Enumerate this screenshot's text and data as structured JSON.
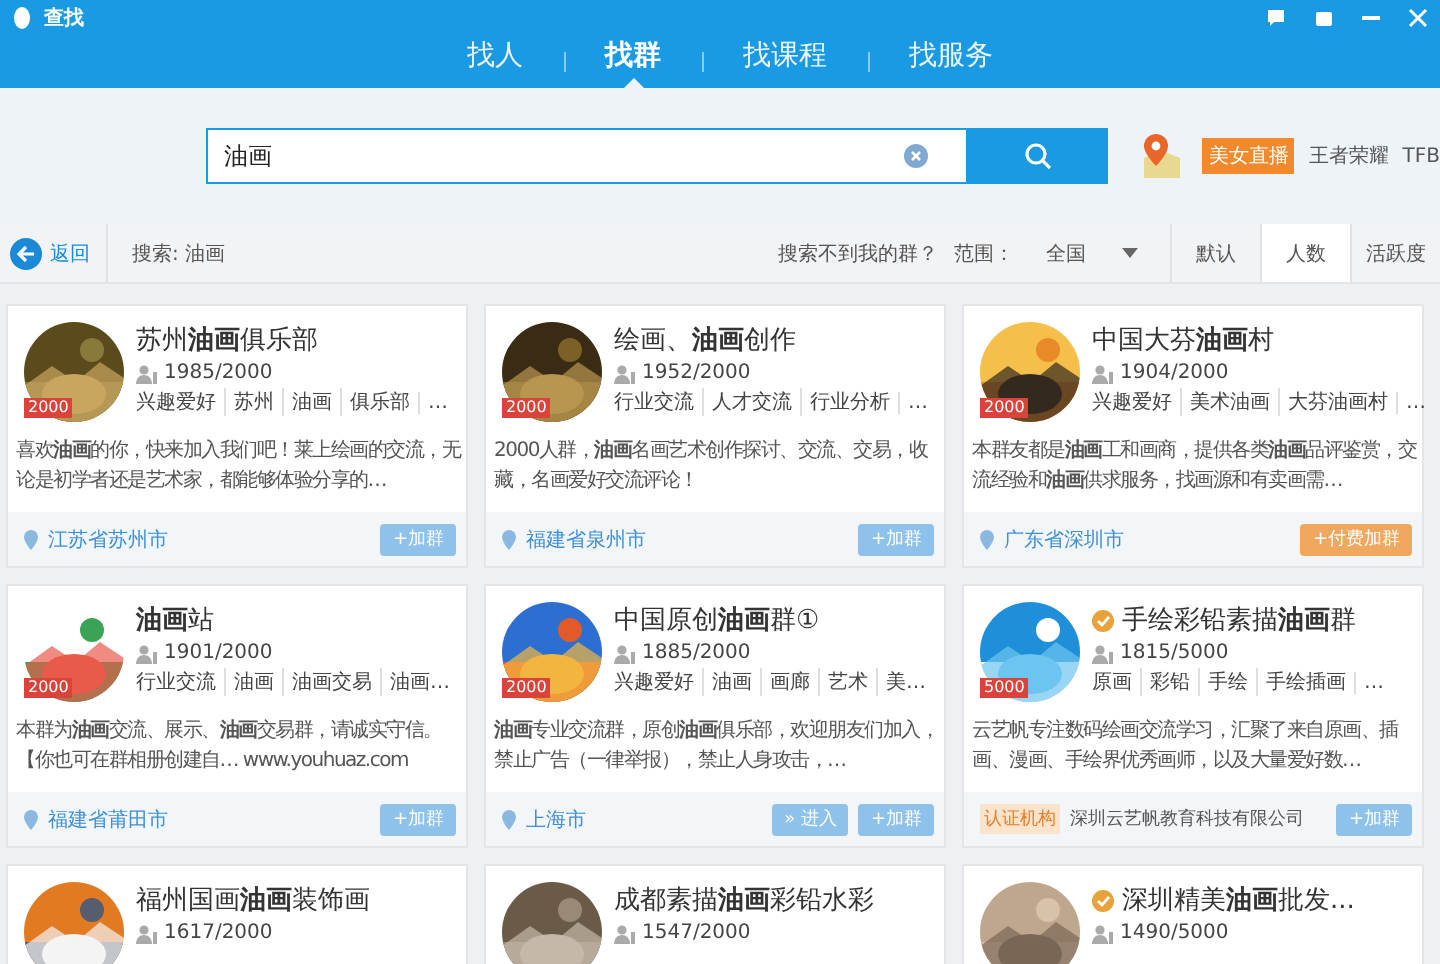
{
  "window": {
    "title": "查找"
  },
  "nav_tabs": [
    {
      "label": "找人",
      "selected": false
    },
    {
      "label": "找群",
      "selected": true
    },
    {
      "label": "找课程",
      "selected": false
    },
    {
      "label": "找服务",
      "selected": false
    }
  ],
  "search": {
    "value": "油画"
  },
  "hot_words": [
    {
      "text": "美女直播",
      "kind": "badge"
    },
    {
      "text": "王者荣耀",
      "kind": "plain"
    },
    {
      "text": "TFB",
      "kind": "plain"
    }
  ],
  "toolbar": {
    "back": "返回",
    "query": "搜索: 油画",
    "help_link": "搜索不到我的群？",
    "range_label": "范围：",
    "range_value": "全国",
    "sort_tabs": [
      {
        "label": "默认",
        "selected": false
      },
      {
        "label": "人数",
        "selected": true
      },
      {
        "label": "活跃度",
        "selected": false
      }
    ]
  },
  "groups": [
    {
      "name": "苏州**油画**俱乐部",
      "verified": false,
      "badge": "2000",
      "count": "1985/2000",
      "tags": [
        "兴趣爱好",
        "苏州",
        "油画",
        "俱乐部",
        "…"
      ],
      "description": "喜欢**油画**的你，快来加入我们吧！莱上绘画的交流，无论是初学者还是艺术家，都能够体验分享的…",
      "location": "江苏省苏州市",
      "buttons": [
        {
          "label": "+加群",
          "kind": "join"
        }
      ]
    },
    {
      "name": "绘画、**油画**创作",
      "verified": false,
      "badge": "2000",
      "count": "1952/2000",
      "tags": [
        "行业交流",
        "人才交流",
        "行业分析",
        "…"
      ],
      "description": "2000人群，**油画**名画艺术创作探讨、交流、交易，收藏，名画爱好交流评论！",
      "location": "福建省泉州市",
      "buttons": [
        {
          "label": "+加群",
          "kind": "join"
        }
      ]
    },
    {
      "name": "中国大芬**油画**村",
      "verified": false,
      "badge": "2000",
      "count": "1904/2000",
      "tags": [
        "兴趣爱好",
        "美术油画",
        "大芬油画村",
        "…"
      ],
      "description": "本群友都是**油画**工和画商，提供各类**油画**品评鉴赏，交流经验和**油画**供求服务，找画源和有卖画需…",
      "location": "广东省深圳市",
      "buttons": [
        {
          "label": "+付费加群",
          "kind": "paid"
        }
      ]
    },
    {
      "name": "**油画**站",
      "verified": false,
      "badge": "2000",
      "count": "1901/2000",
      "tags": [
        "行业交流",
        "油画",
        "油画交易",
        "油画…"
      ],
      "description": "本群为**油画**交流、展示、**油画**交易群，请诚实守信。【你也可在群相册创建自… www.youhuaz.com",
      "location": "福建省莆田市",
      "buttons": [
        {
          "label": "+加群",
          "kind": "join"
        }
      ]
    },
    {
      "name": "中国原创**油画**群①",
      "verified": false,
      "badge": "2000",
      "count": "1885/2000",
      "tags": [
        "兴趣爱好",
        "油画",
        "画廊",
        "艺术",
        "美…"
      ],
      "description": "**油画**专业交流群，原创**油画**俱乐部，欢迎朋友们加入，禁止广告（一律举报），禁止人身攻击，…",
      "location": "上海市",
      "buttons": [
        {
          "label": "» 进入",
          "kind": "enter"
        },
        {
          "label": "+加群",
          "kind": "join"
        }
      ]
    },
    {
      "name": "手绘彩铅素描**油画**群",
      "verified": true,
      "badge": "5000",
      "count": "1815/5000",
      "tags": [
        "原画",
        "彩铅",
        "手绘",
        "手绘插画",
        "…"
      ],
      "description": "云艺帆专注数码绘画交流学习，汇聚了来自原画、插画、漫画、手绘界优秀画师，以及大量爱好数…",
      "org_label": "认证机构",
      "org_name": "深圳云艺帆教育科技有限公司",
      "buttons": [
        {
          "label": "+加群",
          "kind": "join"
        }
      ]
    },
    {
      "name": "福州国画**油画**装饰画",
      "verified": false,
      "count": "1617/2000"
    },
    {
      "name": "成都素描**油画**彩铅水彩",
      "verified": false,
      "count": "1547/2000"
    },
    {
      "name": "深圳精美**油画**批发...",
      "verified": true,
      "count": "1490/5000"
    }
  ]
}
